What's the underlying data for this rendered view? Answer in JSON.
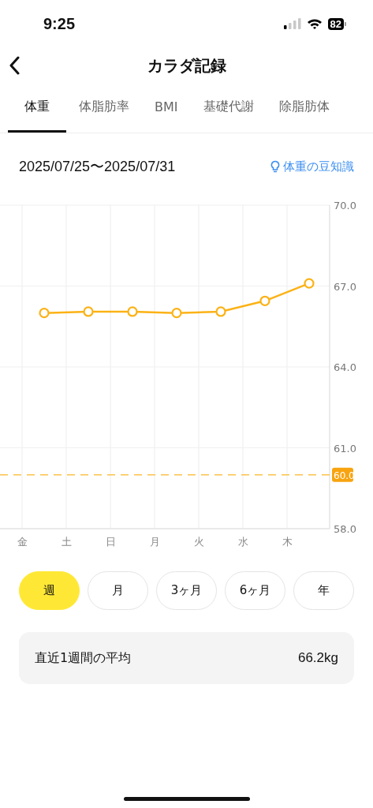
{
  "status_bar": {
    "time": "9:25",
    "battery": "82"
  },
  "header": {
    "title": "カラダ記録"
  },
  "tabs": [
    {
      "label": "体重",
      "selected": true
    },
    {
      "label": "体脂肪率",
      "selected": false
    },
    {
      "label": "BMI",
      "selected": false
    },
    {
      "label": "基礎代謝",
      "selected": false
    },
    {
      "label": "除脂肪体",
      "selected": false
    }
  ],
  "date_range": "2025/07/25〜2025/07/31",
  "tips_link": "体重の豆知識",
  "chart": {
    "chart_data": {
      "type": "line",
      "categories": [
        "金",
        null,
        "土",
        null,
        "日",
        null,
        "月",
        null,
        "火",
        null,
        "水",
        null,
        "木",
        null
      ],
      "grid": true,
      "series": [
        {
          "color": "#fbb216",
          "marker": "o",
          "values": [
            null,
            66.0,
            null,
            66.05,
            null,
            66.05,
            null,
            66.0,
            null,
            66.05,
            null,
            66.45,
            null,
            67.1
          ]
        }
      ],
      "ylim": [
        58,
        70
      ],
      "yticks": [
        {
          "value": 70,
          "label": "70.0"
        },
        {
          "value": 67,
          "label": "67.0"
        },
        {
          "value": 64,
          "label": "64.0"
        },
        {
          "value": 61,
          "label": "61.0"
        },
        {
          "value": 58,
          "label": "58.0"
        }
      ],
      "ref_lines": [
        {
          "axis": "y",
          "value": 60,
          "label": "60.0",
          "color": "#fbc24a"
        }
      ]
    }
  },
  "periods": [
    {
      "label": "週",
      "selected": true
    },
    {
      "label": "月",
      "selected": false
    },
    {
      "label": "3ヶ月",
      "selected": false
    },
    {
      "label": "6ヶ月",
      "selected": false
    },
    {
      "label": "年",
      "selected": false
    }
  ],
  "average": {
    "label": "直近1週間の平均",
    "value": "66.2kg"
  }
}
